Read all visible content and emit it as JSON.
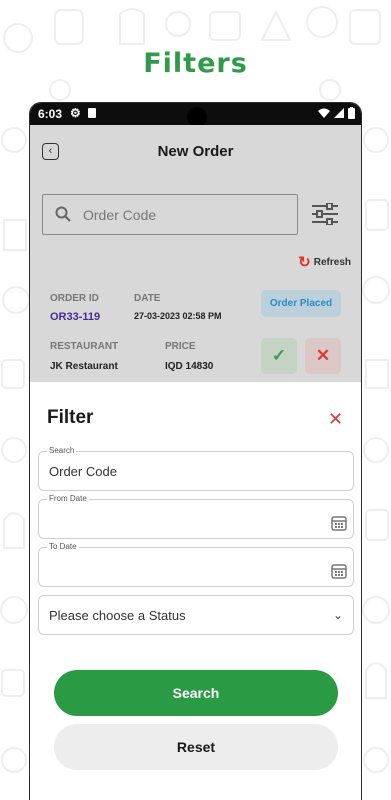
{
  "headline": "Filters",
  "status_bar": {
    "time": "6:03"
  },
  "app_bar": {
    "title": "New Order"
  },
  "search": {
    "placeholder": "Order Code"
  },
  "refresh": {
    "label": "Refresh"
  },
  "order": {
    "id_label": "ORDER ID",
    "id_value": "OR33-119",
    "date_label": "DATE",
    "date_value": "27-03-2023 02:58 PM",
    "restaurant_label": "RESTAURANT",
    "restaurant_value": "JK Restaurant",
    "price_label": "PRICE",
    "price_value": "IQD 14830",
    "status": "Order Placed"
  },
  "filter_sheet": {
    "title": "Filter",
    "search_label": "Search",
    "search_value": "Order Code",
    "from_label": "From Date",
    "from_value": "",
    "to_label": "To Date",
    "to_value": "",
    "status_value": "Please choose a Status",
    "search_button": "Search",
    "reset_button": "Reset"
  },
  "colors": {
    "brand_green": "#2b9a45",
    "danger_red": "#d93b3b",
    "badge_blue": "#2b8bc2"
  },
  "icons": [
    "settings-icon",
    "sd-card-icon",
    "wifi-icon",
    "signal-icon",
    "battery-icon",
    "back-icon",
    "search-icon",
    "filter-sliders-icon",
    "refresh-icon",
    "check-icon",
    "close-icon",
    "calendar-icon",
    "chevron-down-icon"
  ]
}
